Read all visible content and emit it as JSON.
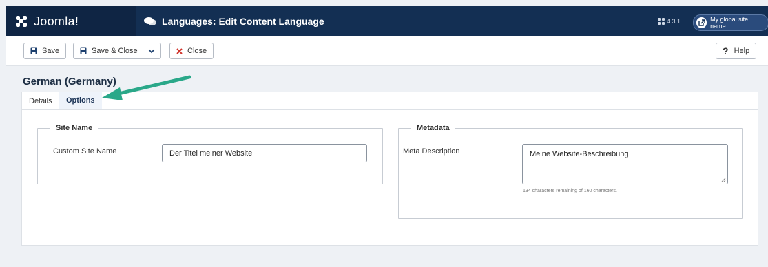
{
  "header": {
    "logo_text": "Joomla!",
    "page_title": "Languages: Edit Content Language",
    "version": "4.3.1",
    "site_name_button": "My global site name"
  },
  "toolbar": {
    "save_label": "Save",
    "save_close_label": "Save & Close",
    "close_label": "Close",
    "help_label": "Help",
    "help_mark": "?"
  },
  "item": {
    "title": "German (Germany)"
  },
  "tabs": [
    {
      "label": "Details",
      "active": false
    },
    {
      "label": "Options",
      "active": true
    }
  ],
  "site_name_fieldset": {
    "legend": "Site Name",
    "custom_site_name_label": "Custom Site Name",
    "custom_site_name_value": "Der Titel meiner Website"
  },
  "metadata_fieldset": {
    "legend": "Metadata",
    "meta_description_label": "Meta Description",
    "meta_description_value": "Meine Website-Beschreibung",
    "char_counter": "134 characters remaining of 160 characters."
  },
  "colors": {
    "header_bg": "#132f53",
    "arrow": "#2aa889",
    "close_icon": "#d0342c"
  }
}
